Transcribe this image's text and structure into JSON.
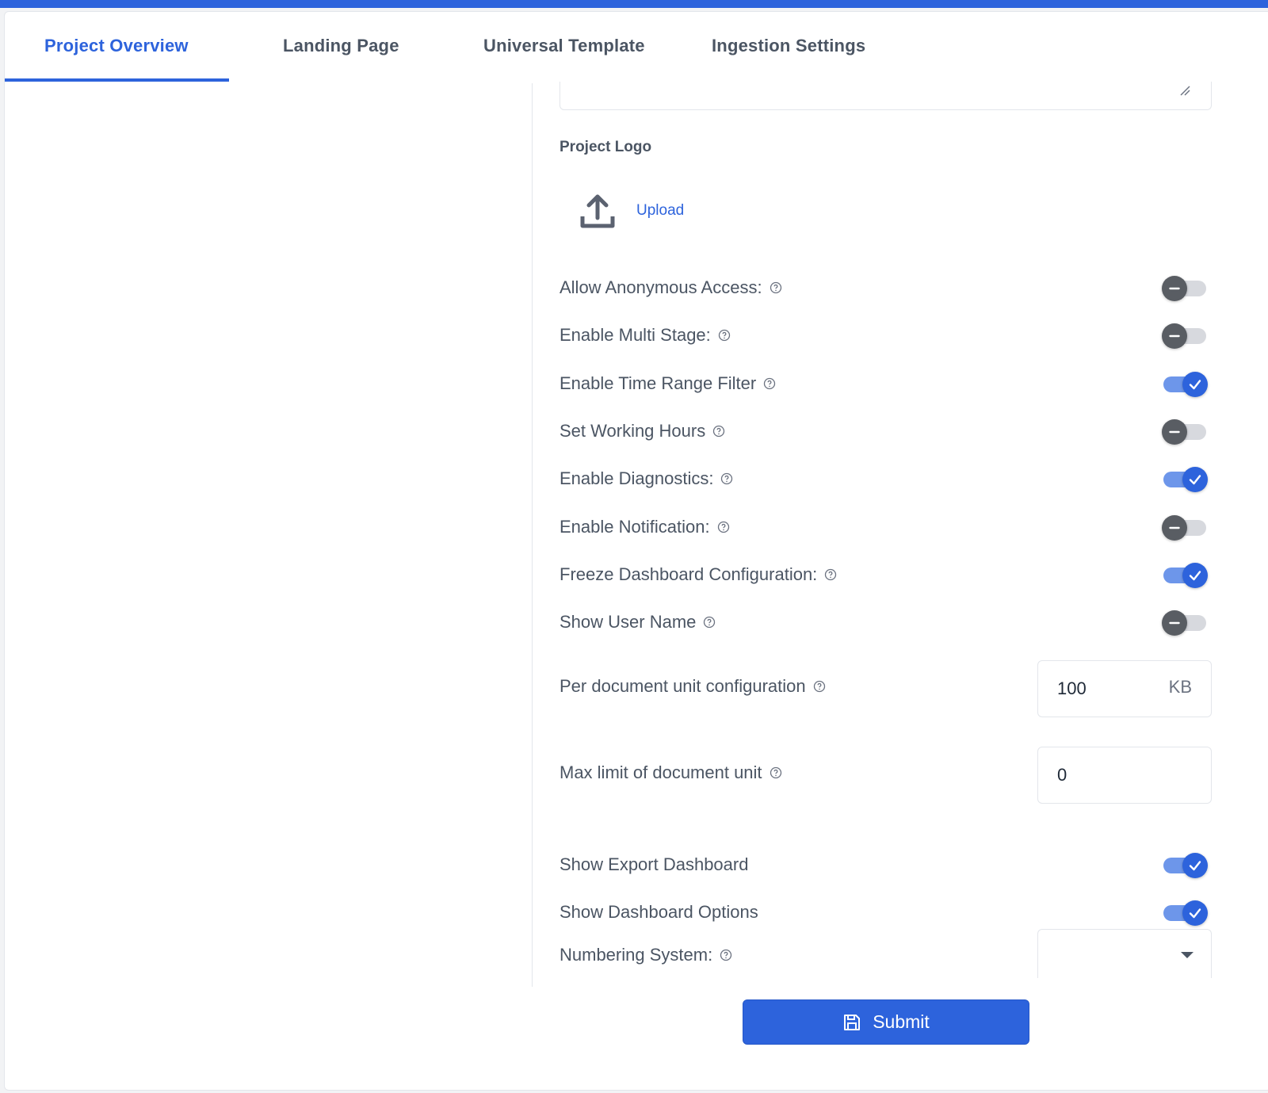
{
  "tabs": [
    {
      "label": "Project Overview",
      "active": true
    },
    {
      "label": "Landing Page",
      "active": false
    },
    {
      "label": "Universal Template",
      "active": false
    },
    {
      "label": "Ingestion Settings",
      "active": false
    }
  ],
  "logo": {
    "label": "Project Logo",
    "upload_label": "Upload",
    "icon": "upload-icon"
  },
  "settings": [
    {
      "label": "Allow Anonymous Access:",
      "help": true,
      "enabled": false
    },
    {
      "label": "Enable Multi Stage:",
      "help": true,
      "enabled": false
    },
    {
      "label": "Enable Time Range Filter",
      "help": true,
      "enabled": true
    },
    {
      "label": "Set Working Hours",
      "help": true,
      "enabled": false
    },
    {
      "label": "Enable Diagnostics:",
      "help": true,
      "enabled": true
    },
    {
      "label": "Enable Notification:",
      "help": true,
      "enabled": false
    },
    {
      "label": "Freeze Dashboard Configuration:",
      "help": true,
      "enabled": true
    },
    {
      "label": "Show User Name",
      "help": true,
      "enabled": false
    }
  ],
  "per_document": {
    "label": "Per document unit configuration",
    "value": "100",
    "unit": "KB"
  },
  "max_limit": {
    "label": "Max limit of document unit",
    "value": "0"
  },
  "extra_settings": [
    {
      "label": "Show Export Dashboard",
      "enabled": true
    },
    {
      "label": "Show Dashboard Options",
      "enabled": true
    }
  ],
  "numbering": {
    "label": "Numbering System:",
    "selected": ""
  },
  "submit": {
    "label": "Submit",
    "icon": "save-icon"
  },
  "colors": {
    "accent": "#2d63dc",
    "text": "#4b5563",
    "toggle_off_knob": "#595d63"
  }
}
